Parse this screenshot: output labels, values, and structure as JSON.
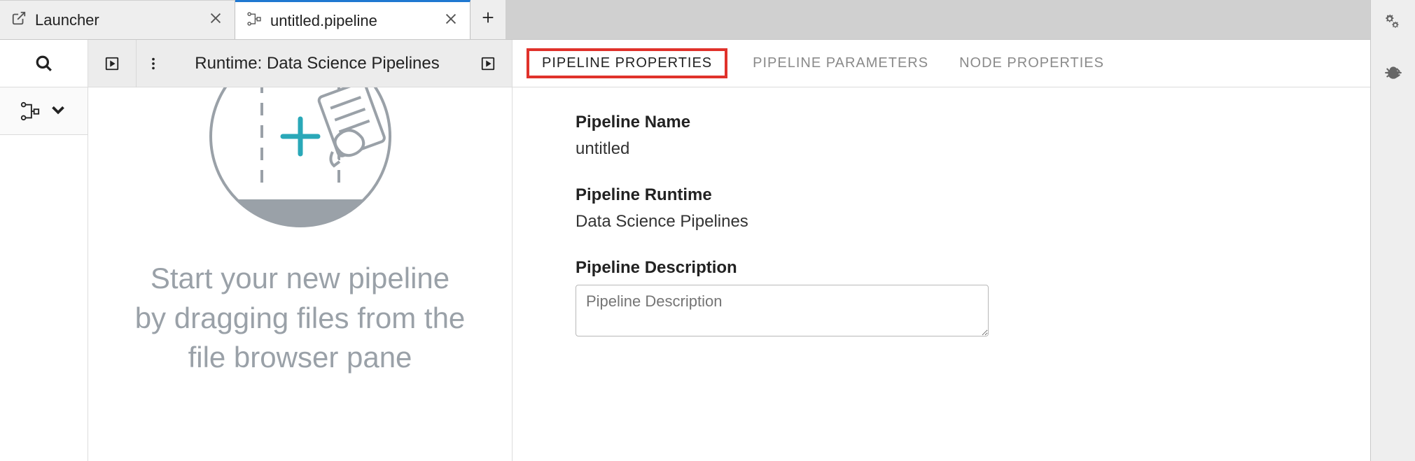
{
  "tabs": {
    "launcher": {
      "label": "Launcher"
    },
    "pipeline": {
      "label": "untitled.pipeline"
    }
  },
  "toolbar": {
    "runtime_label": "Runtime: Data Science Pipelines"
  },
  "canvas": {
    "hint": "Start your new pipeline by dragging files from the file browser pane"
  },
  "properties": {
    "tabs": {
      "pipeline_props": "PIPELINE PROPERTIES",
      "pipeline_params": "PIPELINE PARAMETERS",
      "node_props": "NODE PROPERTIES"
    },
    "name_label": "Pipeline Name",
    "name_value": "untitled",
    "runtime_label": "Pipeline Runtime",
    "runtime_value": "Data Science Pipelines",
    "description_label": "Pipeline Description",
    "description_placeholder": "Pipeline Description"
  }
}
